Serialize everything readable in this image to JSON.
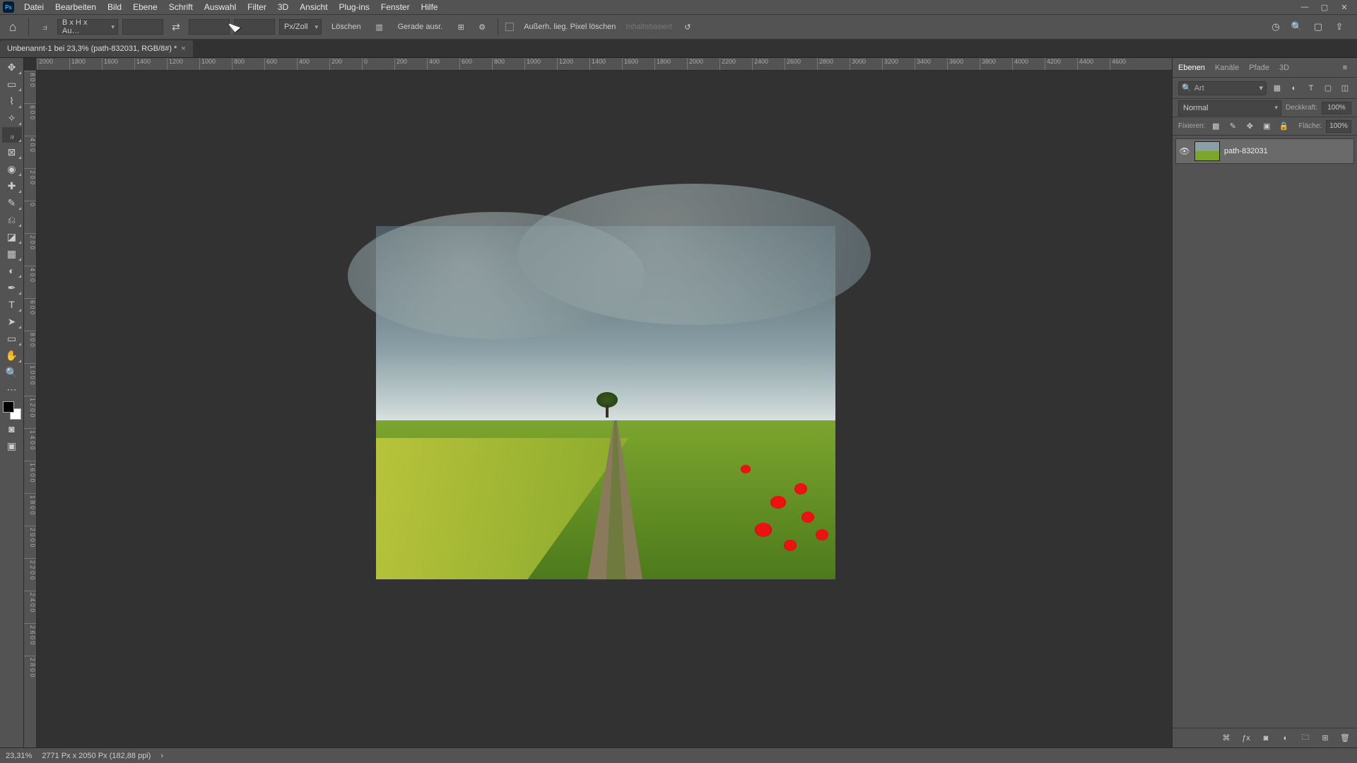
{
  "menubar": {
    "items": [
      "Datei",
      "Bearbeiten",
      "Bild",
      "Ebene",
      "Schrift",
      "Auswahl",
      "Filter",
      "3D",
      "Ansicht",
      "Plug-ins",
      "Fenster",
      "Hilfe"
    ]
  },
  "optionsbar": {
    "ratio_preset": "B x H x Au…",
    "width": "",
    "height": "",
    "resolution": "",
    "unit": "Px/Zoll",
    "clear": "Löschen",
    "straighten": "Gerade ausr.",
    "delete_cropped": "Außerh. lieg. Pixel löschen",
    "content_aware": "Inhaltsbasiert"
  },
  "document": {
    "tab_title": "Unbenannt-1 bei 23,3% (path-832031, RGB/8#) *"
  },
  "ruler_h": [
    "2000",
    "1800",
    "1600",
    "1400",
    "1200",
    "1000",
    "800",
    "600",
    "400",
    "200",
    "0",
    "200",
    "400",
    "600",
    "800",
    "1000",
    "1200",
    "1400",
    "1600",
    "1800",
    "2000",
    "2200",
    "2400",
    "2600",
    "2800",
    "3000",
    "3200",
    "3400",
    "3600",
    "3800",
    "4000",
    "4200",
    "4400",
    "4600"
  ],
  "ruler_v": [
    "8 0 0",
    "6 0 0",
    "4 0 0",
    "2 0 0",
    "0",
    "2 0 0",
    "4 0 0",
    "6 0 0",
    "8 0 0",
    "1 0 0 0",
    "1 2 0 0",
    "1 4 0 0",
    "1 6 0 0",
    "1 8 0 0",
    "2 0 0 0",
    "2 2 0 0",
    "2 4 0 0",
    "2 6 0 0",
    "2 8 0 0"
  ],
  "panels": {
    "tabs": [
      "Ebenen",
      "Kanäle",
      "Pfade",
      "3D"
    ],
    "search_placeholder": "Art",
    "blend_mode": "Normal",
    "opacity_label": "Deckkraft:",
    "opacity_value": "100%",
    "lock_label": "Fixieren:",
    "fill_label": "Fläche:",
    "fill_value": "100%",
    "layers": [
      {
        "name": "path-832031"
      }
    ]
  },
  "statusbar": {
    "zoom": "23,31%",
    "doc_info": "2771 Px x 2050 Px (182,88 ppi)"
  }
}
